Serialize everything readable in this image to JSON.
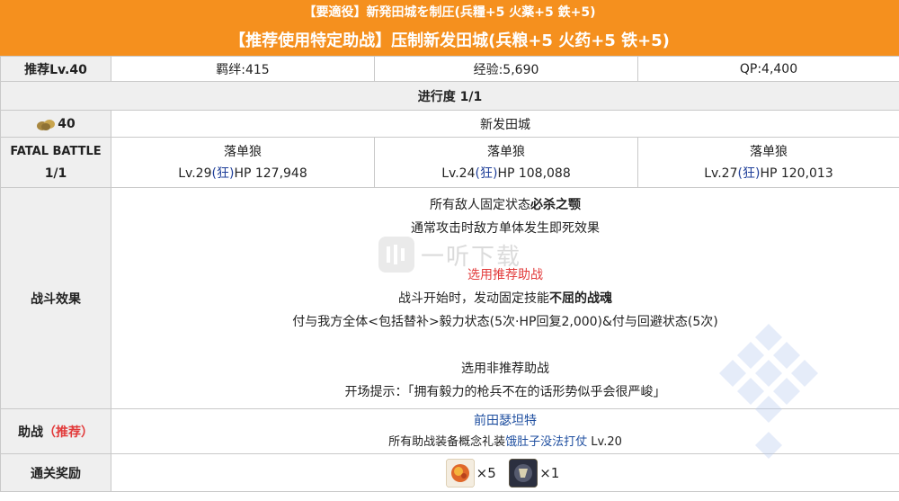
{
  "header": {
    "subtitle": "【要適役】新発田城を制圧(兵糧+5 火薬+5 鉄+5)",
    "title": "【推荐使用特定助战】压制新发田城(兵粮+5 火药+5 铁+5)"
  },
  "stats_row": {
    "level": "推荐Lv.40",
    "bond": "羁绊:415",
    "exp": "经验:5,690",
    "qp": "QP:4,400"
  },
  "progress": "进行度 1/1",
  "ap_row": {
    "ap": "40",
    "location": "新发田城"
  },
  "battle": {
    "label_line1": "FATAL BATTLE",
    "label_line2": "1/1",
    "enemies": [
      {
        "name": "落单狼",
        "lv": "Lv.29",
        "cls": "(狂)",
        "hp": "HP 127,948"
      },
      {
        "name": "落单狼",
        "lv": "Lv.24",
        "cls": "(狂)",
        "hp": "HP 108,088"
      },
      {
        "name": "落单狼",
        "lv": "Lv.27",
        "cls": "(狂)",
        "hp": "HP 120,013"
      }
    ]
  },
  "effects": {
    "label": "战斗效果",
    "line1_prefix": "所有敌人固定状态",
    "line1_bold": "必杀之颚",
    "line2": "通常攻击时敌方单体发生即死效果",
    "recommended": "选用推荐助战",
    "line4_prefix": "战斗开始时，发动固定技能",
    "line4_bold": "不屈的战魂",
    "line5": "付与我方全体<包括替补>毅力状态(5次·HP回复2,000)&付与回避状态(5次)",
    "non_recommended": "选用非推荐助战",
    "line7": "开场提示：「拥有毅力的枪兵不在的话形势似乎会很严峻」"
  },
  "support": {
    "label_prefix": "助战",
    "label_red": "（推荐）",
    "servant": "前田瑟坦特",
    "note_prefix": "所有助战装备概念礼装",
    "ce_name": "饿肚子没法打仗",
    "ce_lv": "Lv.20"
  },
  "rewards": {
    "label": "通关奖励",
    "item1_count": "×5",
    "item2_count": "×1"
  },
  "watermark": {
    "text": "一听下载"
  },
  "colors": {
    "header_orange": "#f5901e",
    "label_bg": "#efefef",
    "border": "#c9c9c9",
    "red": "#e23a3a",
    "link_blue": "#1f4fa0"
  }
}
